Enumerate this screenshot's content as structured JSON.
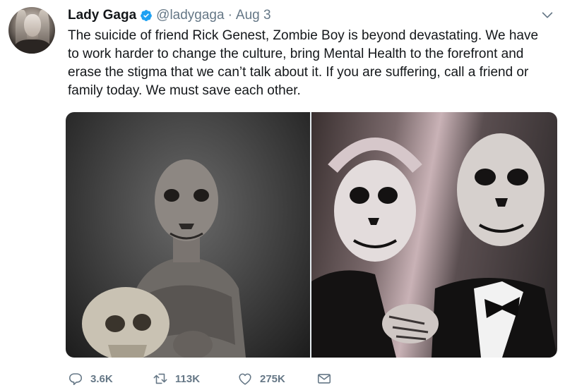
{
  "tweet": {
    "author_name": "Lady Gaga",
    "handle": "@ladygaga",
    "separator": "·",
    "date": "Aug 3",
    "verified": true,
    "text": "The suicide of friend Rick Genest, Zombie Boy is beyond devastating. We have\nto work harder to change the culture, bring Mental Health to the forefront and\nerase the stigma that we can’t talk about it. If you are suffering, call a friend or\nfamily today. We must save each other.",
    "media": [
      {
        "description": "tattooed-man-holding-skull-photo"
      },
      {
        "description": "skull-makeup-couple-photo"
      }
    ]
  },
  "actions": {
    "replies": "3.6K",
    "retweets": "113K",
    "likes": "275K"
  },
  "icons": {
    "verified": "verified-badge-icon",
    "menu": "chevron-down-icon",
    "reply": "reply-icon",
    "retweet": "retweet-icon",
    "like": "heart-icon",
    "message": "envelope-icon"
  },
  "colors": {
    "text": "#14171a",
    "secondary": "#657786",
    "verified": "#1da1f2",
    "icon": "#657786"
  }
}
